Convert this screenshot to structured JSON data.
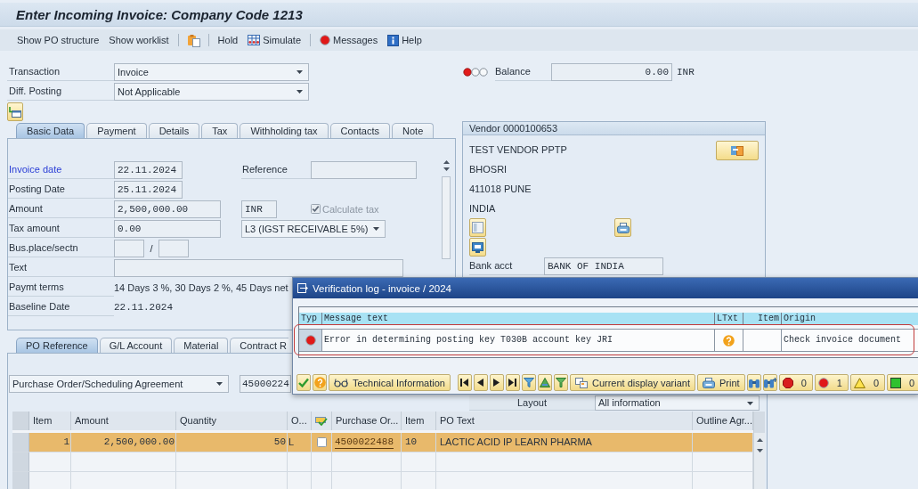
{
  "window": {
    "title": "Enter Incoming Invoice: Company Code 1213"
  },
  "toolbar": [
    [
      {
        "kind": "plain",
        "label": "Show PO structure"
      },
      {
        "kind": "plain",
        "label": "Show worklist"
      }
    ],
    [
      {
        "kind": "paste"
      }
    ],
    [
      {
        "kind": "plain",
        "label": "Hold"
      },
      {
        "kind": "simulate",
        "label": "Simulate"
      }
    ],
    [
      {
        "kind": "messages",
        "label": "Messages"
      },
      {
        "kind": "help",
        "label": "Help"
      }
    ]
  ],
  "header": {
    "transaction": {
      "label": "Transaction",
      "value": "Invoice"
    },
    "diff_posting": {
      "label": "Diff. Posting",
      "value": "Not Applicable"
    }
  },
  "balance": {
    "kind": "error",
    "label": "Balance",
    "value": "0.00",
    "currency": "INR"
  },
  "header_tabs": [
    {
      "label": "Basic Data",
      "selected": true
    },
    {
      "label": "Payment",
      "selected": false
    },
    {
      "label": "Details",
      "selected": false
    },
    {
      "label": "Tax",
      "selected": false
    },
    {
      "label": "Withholding tax",
      "selected": false
    },
    {
      "label": "Contacts",
      "selected": false
    },
    {
      "label": "Note",
      "selected": false
    }
  ],
  "basic_data": {
    "rows": [
      {
        "kind": "date",
        "label": "Invoice date",
        "highlighted": true,
        "value": "22.11.2024",
        "side": {
          "kind": "labeled",
          "label": "Reference"
        }
      },
      {
        "kind": "date",
        "label": "Posting Date",
        "highlighted": false,
        "value": "25.11.2024"
      },
      {
        "kind": "amount",
        "label": "Amount",
        "highlighted": false,
        "value": "2,500,000.00",
        "side": {
          "kind": "currency",
          "value": "INR",
          "checkbox": {
            "label": "Calculate tax",
            "checked": true,
            "disabled": true
          }
        }
      },
      {
        "kind": "amount",
        "label": "Tax amount",
        "highlighted": false,
        "value": "0.00",
        "side": {
          "kind": "dropdown",
          "value": "L3 (IGST RECEIVABLE 5%)"
        }
      },
      {
        "kind": "split",
        "label": "Bus.place/sectn",
        "highlighted": false,
        "separator": "/"
      },
      {
        "kind": "long",
        "label": "Text",
        "highlighted": false
      },
      {
        "kind": "terms",
        "label": "Paymt terms",
        "highlighted": false,
        "value": "14 Days 3 %, 30 Days 2 %, 45 Days net"
      },
      {
        "kind": "display",
        "label": "Baseline Date",
        "highlighted": false,
        "value": "22.11.2024"
      }
    ]
  },
  "vendor": {
    "title": "Vendor 0000100653",
    "address": [
      "TEST VENDOR PPTP",
      "BHOSRI",
      "411018 PUNE",
      "INDIA"
    ],
    "bank": {
      "label": "Bank acct",
      "value": "BANK OF INDIA"
    }
  },
  "item_tabs": [
    {
      "label": "PO Reference",
      "selected": true
    },
    {
      "label": "G/L Account",
      "selected": false
    },
    {
      "label": "Material",
      "selected": false
    },
    {
      "label": "Contract R",
      "selected": false
    }
  ],
  "reference": {
    "type": "Purchase Order/Scheduling Agreement",
    "number": "45000224"
  },
  "layout": {
    "label": "Layout",
    "value": "All information"
  },
  "items_table": {
    "columns": [
      {
        "kind": "text",
        "label": "Item"
      },
      {
        "kind": "text",
        "label": "Amount"
      },
      {
        "kind": "text",
        "label": "Quantity"
      },
      {
        "kind": "text",
        "label": "O..."
      },
      {
        "kind": "icon"
      },
      {
        "kind": "text",
        "label": "Purchase Or..."
      },
      {
        "kind": "text",
        "label": "Item"
      },
      {
        "kind": "text",
        "label": "PO Text"
      },
      {
        "kind": "text",
        "label": "Outline Agr..."
      }
    ],
    "rows": [
      {
        "selected": true,
        "item": "1",
        "amount": "2,500,000.00",
        "quantity": "50",
        "unit": "L",
        "checked": false,
        "po_number": "4500022488",
        "po_item": "10",
        "po_text": "LACTIC ACID IP LEARN PHARMA"
      }
    ]
  },
  "verification_log": {
    "title": "Verification log - invoice / 2024",
    "columns": [
      "Typ",
      "Message text",
      "LTxt",
      "Item",
      "Origin"
    ],
    "messages": [
      {
        "kind": "error",
        "text": "Error in determining posting key T030B account key JRI",
        "long_text": true,
        "origin": "Check invoice document",
        "highlighted": true
      }
    ],
    "toolbar": [
      {
        "kind": "confirm"
      },
      {
        "kind": "help"
      },
      {
        "kind": "technical",
        "label": "Technical Information"
      },
      {
        "kind": "first"
      },
      {
        "kind": "previous"
      },
      {
        "kind": "next"
      },
      {
        "kind": "last"
      },
      {
        "kind": "filter"
      },
      {
        "kind": "sum"
      },
      {
        "kind": "subtotal"
      },
      {
        "kind": "variant",
        "label": "Current display variant"
      },
      {
        "kind": "print",
        "label": "Print"
      },
      {
        "kind": "find"
      },
      {
        "kind": "findnext"
      },
      {
        "kind": "stop",
        "label": "0"
      },
      {
        "kind": "error",
        "label": "1"
      },
      {
        "kind": "warning",
        "label": "0"
      },
      {
        "kind": "success",
        "label": "0"
      }
    ]
  }
}
